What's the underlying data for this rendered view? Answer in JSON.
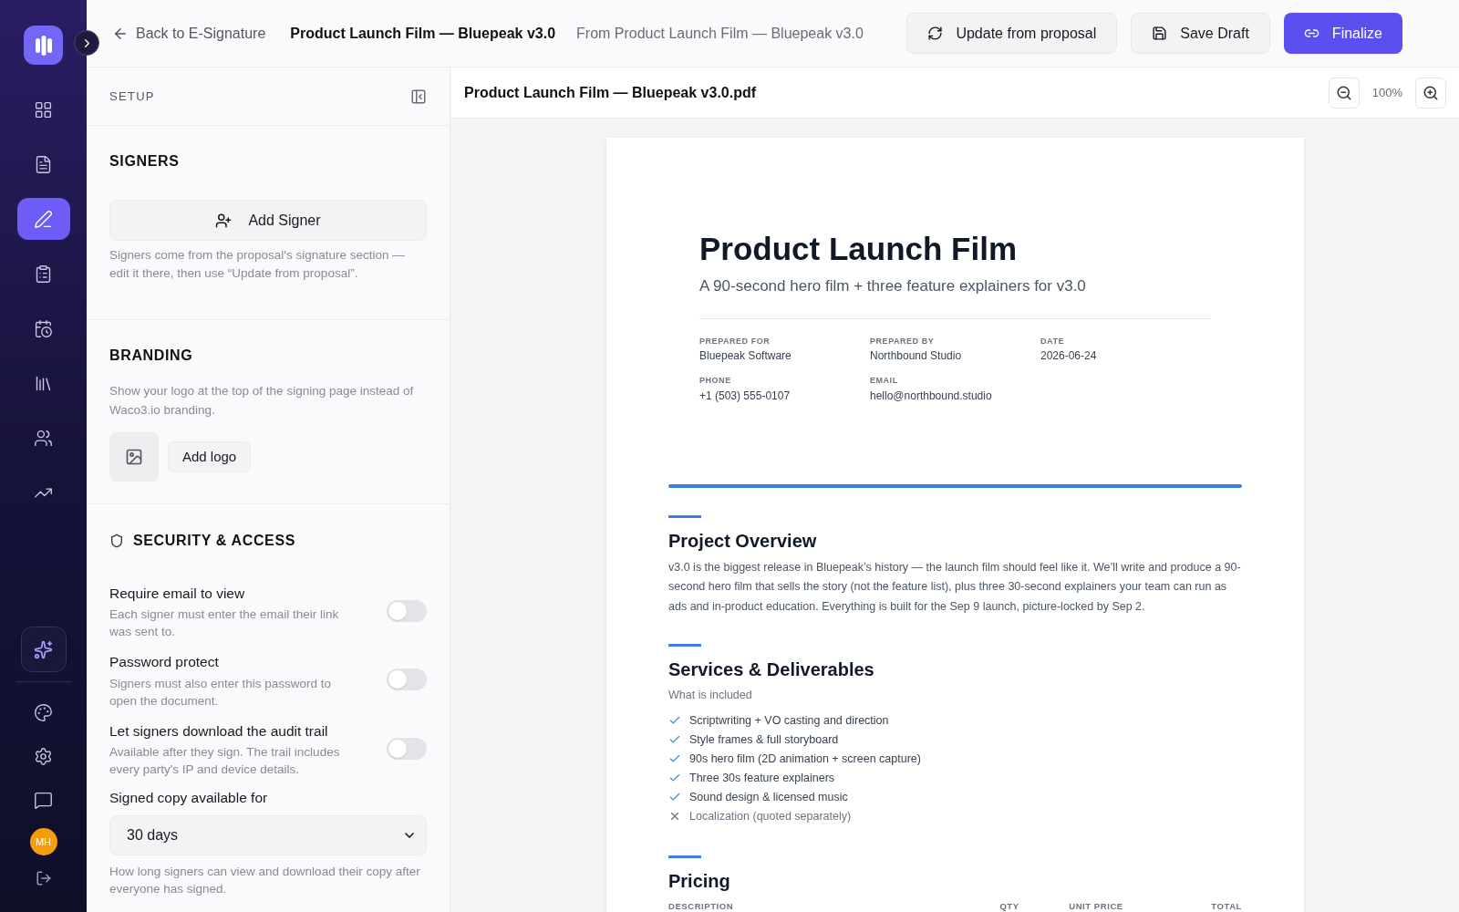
{
  "sidebar": {
    "nav_items": [
      {
        "selected": false
      },
      {
        "selected": false
      },
      {
        "selected": true
      },
      {
        "selected": false
      },
      {
        "selected": false
      },
      {
        "selected": false
      },
      {
        "selected": false
      },
      {
        "selected": false
      }
    ],
    "bottom_items": [
      {
        "selected": false
      },
      {
        "selected": false
      },
      {
        "selected": false
      }
    ],
    "avatar": "MH"
  },
  "topbar": {
    "back": "Back to E-Signature",
    "title": "Product Launch Film — Bluepeak v3.0",
    "source": "From Product Launch Film — Bluepeak v3.0",
    "buttons": [
      {
        "label": "Update from proposal",
        "kind": "secondary"
      },
      {
        "label": "Save Draft",
        "kind": "secondary"
      },
      {
        "label": "Finalize",
        "kind": "primary"
      }
    ]
  },
  "setup": {
    "title": "SETUP",
    "signers": {
      "title": "SIGNERS",
      "button": "Add Signer",
      "note": "Signers come from the proposal's signature section — edit it there, then use “Update from proposal”."
    },
    "branding": {
      "title": "BRANDING",
      "note": "Show your logo at the top of the signing page instead of Waco3.io branding.",
      "button": "Add logo"
    },
    "security": {
      "title": "SECURITY & ACCESS",
      "options": [
        {
          "label": "Require email to view",
          "description": "Each signer must enter the email their link was sent to.",
          "on": false
        },
        {
          "label": "Password protect",
          "description": "Signers must also enter this password to open the document.",
          "on": false
        },
        {
          "label": "Let signers download the audit trail",
          "description": "Available after they sign. The trail includes every party's IP and device details.",
          "on": false
        }
      ],
      "select": {
        "label": "Signed copy available for",
        "value": "30 days",
        "help": "How long signers can view and download their copy after everyone has signed."
      }
    }
  },
  "viewer": {
    "filename": "Product Launch Film — Bluepeak v3.0.pdf",
    "zoom": "100%",
    "document": {
      "title": "Product Launch Film",
      "subtitle": "A 90-second hero film + three feature explainers for v3.0",
      "meta": [
        {
          "label": "PREPARED FOR",
          "value": "Bluepeak Software"
        },
        {
          "label": "PREPARED BY",
          "value": "Northbound Studio"
        },
        {
          "label": "DATE",
          "value": "2026-06-24"
        },
        {
          "label": "PHONE",
          "value": "+1 (503) 555-0107"
        },
        {
          "label": "EMAIL",
          "value": "hello@northbound.studio"
        }
      ],
      "overview": {
        "title": "Project Overview",
        "body": "v3.0 is the biggest release in Bluepeak’s history — the launch film should feel like it. We’ll write and produce a 90-second hero film that sells the story (not the feature list), plus three 30-second explainers your team can run as ads and in-product education. Everything is built for the Sep 9 launch, picture-locked by Sep 2."
      },
      "services": {
        "title": "Services & Deliverables",
        "subtitle": "What is included",
        "items": [
          {
            "text": "Scriptwriting + VO casting and direction",
            "included": true
          },
          {
            "text": "Style frames & full storyboard",
            "included": true
          },
          {
            "text": "90s hero film (2D animation + screen capture)",
            "included": true
          },
          {
            "text": "Three 30s feature explainers",
            "included": true
          },
          {
            "text": "Sound design & licensed music",
            "included": true
          },
          {
            "text": "Localization (quoted separately)",
            "included": false
          }
        ]
      },
      "pricing": {
        "title": "Pricing",
        "columns": [
          "DESCRIPTION",
          "QTY",
          "UNIT PRICE",
          "TOTAL"
        ]
      }
    }
  }
}
